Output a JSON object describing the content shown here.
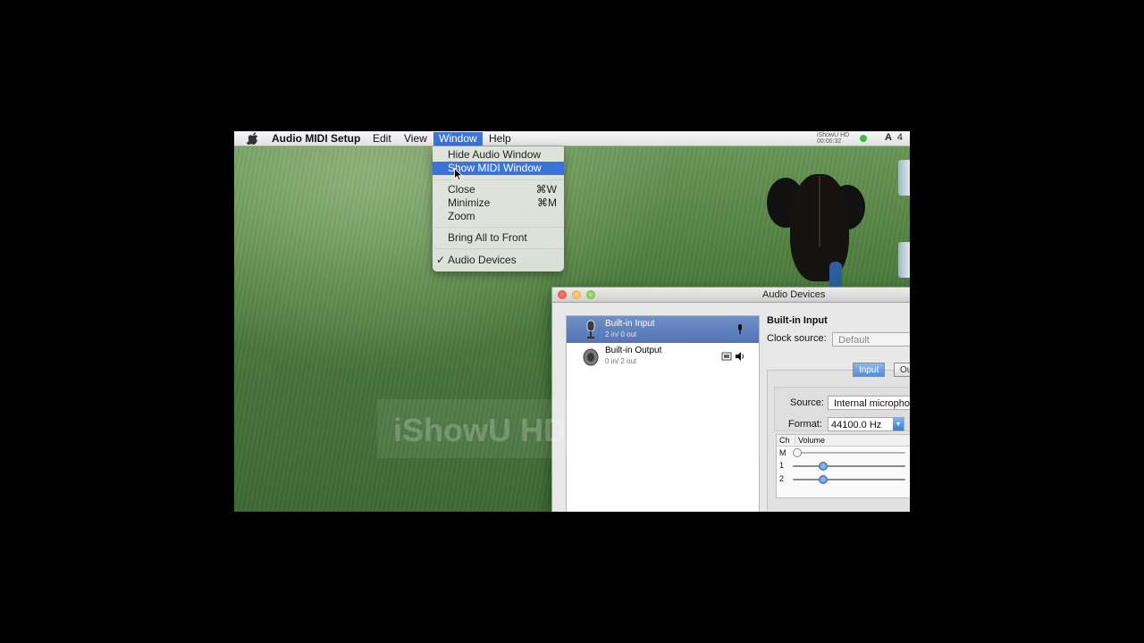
{
  "menubar": {
    "app_name": "Audio MIDI Setup",
    "items": [
      "Edit",
      "View",
      "Window",
      "Help"
    ],
    "active_item": "Window",
    "status": {
      "recorder_line1": "iShowU HD",
      "recorder_line2": "00:00:32",
      "adobe_label": "A",
      "count": "4"
    }
  },
  "window_menu": {
    "items": [
      {
        "label": "Hide Audio Window",
        "shortcut": ""
      },
      {
        "label": "Show MIDI Window",
        "shortcut": "",
        "highlighted": true
      },
      {
        "label": "Close",
        "shortcut": "⌘W"
      },
      {
        "label": "Minimize",
        "shortcut": "⌘M"
      },
      {
        "label": "Zoom",
        "shortcut": ""
      },
      {
        "label": "Bring All to Front",
        "shortcut": ""
      },
      {
        "label": "Audio Devices",
        "shortcut": "",
        "checked": true,
        "check_mark": "✓"
      }
    ]
  },
  "audio_window": {
    "title": "Audio Devices",
    "devices": [
      {
        "name": "Built-in Input",
        "io": "2 in/ 0 out",
        "selected": true,
        "icon": "microphone-icon"
      },
      {
        "name": "Built-in Output",
        "io": "0 in/ 2 out",
        "selected": false,
        "icon": "speaker-icon"
      }
    ],
    "detail": {
      "device_name": "Built-in Input",
      "clock_source_label": "Clock source:",
      "clock_source_value": "Default",
      "tabs": [
        "Input",
        "Ou"
      ],
      "active_tab": "Input",
      "source_label": "Source:",
      "source_value": "Internal micropho",
      "format_label": "Format:",
      "format_value": "44100.0 Hz",
      "volume_header_ch": "Ch",
      "volume_header_volume": "Volume",
      "channels": [
        {
          "ch": "M",
          "level": 0.0
        },
        {
          "ch": "1",
          "level": 0.27
        },
        {
          "ch": "2",
          "level": 0.27
        }
      ]
    }
  },
  "watermark": "iShowU HD Preview",
  "colors": {
    "accent": "#3a74d8",
    "selection": "#5f80bd",
    "menubar": "#ececec"
  }
}
